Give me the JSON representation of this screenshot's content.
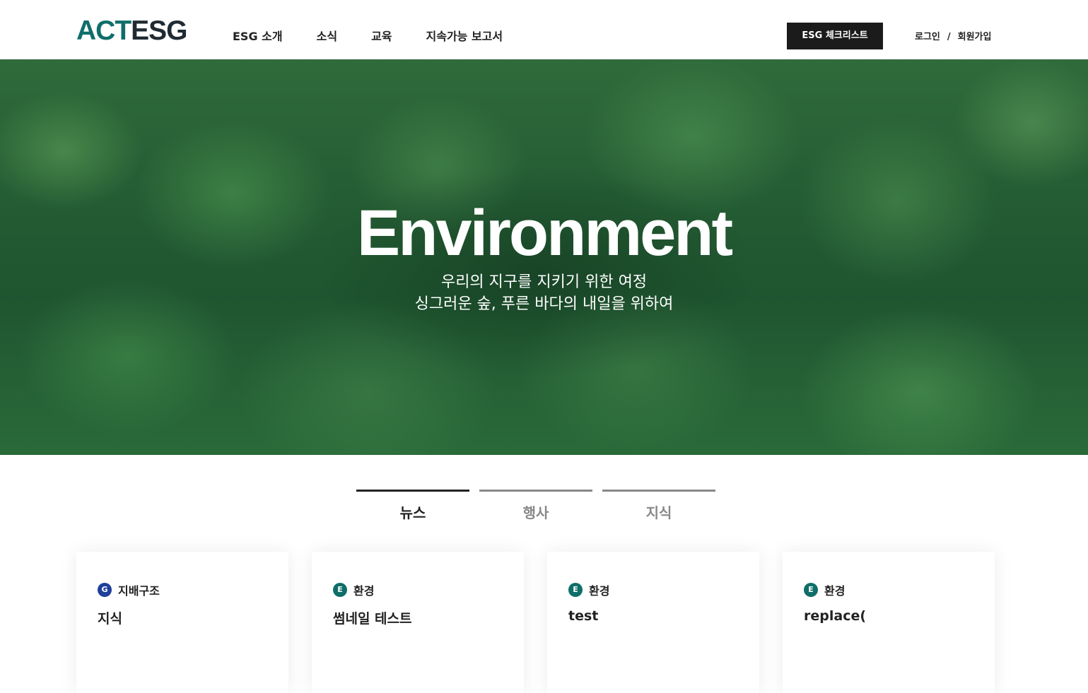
{
  "header": {
    "logo_part1": "ACT",
    "logo_part2": "ESG",
    "nav": [
      "ESG 소개",
      "소식",
      "교육",
      "지속가능 보고서"
    ],
    "checklist_label": "ESG 체크리스트",
    "login_label": "로그인",
    "separator": "/",
    "signup_label": "회원가입"
  },
  "hero": {
    "title": "Environment",
    "subtitle_line1": "우리의 지구를 지키기 위한 여정",
    "subtitle_line2": "싱그러운 숲, 푸른 바다의 내일을 위하여"
  },
  "tabs": [
    {
      "label": "뉴스",
      "active": true
    },
    {
      "label": "행사",
      "active": false
    },
    {
      "label": "지식",
      "active": false
    }
  ],
  "cards": [
    {
      "badge": "G",
      "category": "지배구조",
      "title": "지식",
      "badge_color": "#1e3f9a"
    },
    {
      "badge": "E",
      "category": "환경",
      "title": "썸네일 테스트",
      "badge_color": "#0f6e69"
    },
    {
      "badge": "E",
      "category": "환경",
      "title": "test",
      "badge_color": "#0f6e69"
    },
    {
      "badge": "E",
      "category": "환경",
      "title": "replace(",
      "badge_color": "#0f6e69"
    }
  ],
  "colors": {
    "brand_teal": "#0f6e69",
    "brand_dark": "#1f2a33",
    "button_dark": "#1b1b1b"
  }
}
